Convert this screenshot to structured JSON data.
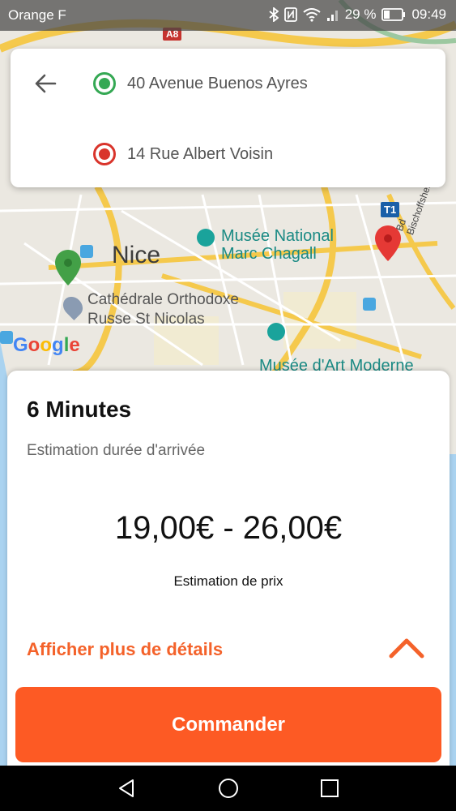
{
  "status_bar": {
    "carrier": "Orange F",
    "battery": "29 %",
    "time": "09:49"
  },
  "map": {
    "city_label": "Nice",
    "poi_chagall": "Musée National\nMarc Chagall",
    "poi_church": "Cathédrale Orthodoxe\nRusse St Nicolas",
    "poi_modern_art": "Musée d'Art Moderne",
    "road_shield": "A8",
    "transit_badge": "T1",
    "street_label": "Bd Bischoffsheim",
    "google_logo": "Google"
  },
  "address_card": {
    "origin": "40 Avenue Buenos Ayres",
    "destination": "14 Rue Albert Voisin"
  },
  "sheet": {
    "eta_title": "6 Minutes",
    "eta_subtitle": "Estimation durée d'arrivée",
    "price_range": "19,00€ - 26,00€",
    "price_label": "Estimation de prix",
    "details_link": "Afficher plus de détails",
    "order_button": "Commander"
  },
  "colors": {
    "accent": "#fd5a24",
    "link": "#f4622a",
    "origin_dot": "#34a853",
    "destination_dot": "#d9342b"
  },
  "icons": [
    "back-arrow-icon",
    "origin-dot-icon",
    "destination-dot-icon",
    "chevron-up-icon",
    "back-nav-icon",
    "home-nav-icon",
    "recents-nav-icon",
    "bluetooth-icon",
    "nfc-icon",
    "wifi-icon",
    "signal-icon",
    "battery-icon"
  ]
}
